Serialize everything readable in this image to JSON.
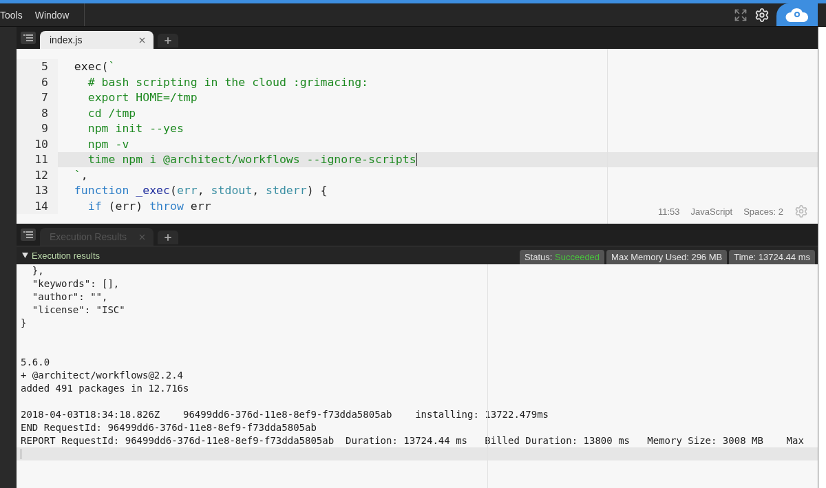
{
  "menu": [
    {
      "label": "Tools"
    },
    {
      "label": "Window"
    }
  ],
  "editor": {
    "tabs": [
      {
        "label": "index.js",
        "selected": true
      }
    ],
    "lines": [
      {
        "number": "5",
        "active": false,
        "tokens": [
          {
            "kind": "plain",
            "text": "  exec("
          },
          {
            "kind": "string",
            "text": "`"
          }
        ]
      },
      {
        "number": "6",
        "active": false,
        "tokens": [
          {
            "kind": "string",
            "text": "    # bash scripting in the cloud :grimacing:"
          }
        ]
      },
      {
        "number": "7",
        "active": false,
        "tokens": [
          {
            "kind": "string",
            "text": "    export HOME=/tmp"
          }
        ]
      },
      {
        "number": "8",
        "active": false,
        "tokens": [
          {
            "kind": "string",
            "text": "    cd /tmp"
          }
        ]
      },
      {
        "number": "9",
        "active": false,
        "tokens": [
          {
            "kind": "string",
            "text": "    npm init --yes"
          }
        ]
      },
      {
        "number": "10",
        "active": false,
        "tokens": [
          {
            "kind": "string",
            "text": "    npm -v"
          }
        ]
      },
      {
        "number": "11",
        "active": true,
        "tokens": [
          {
            "kind": "string",
            "text": "    time npm i @architect/workflows --ignore-scripts"
          }
        ]
      },
      {
        "number": "12",
        "active": false,
        "tokens": [
          {
            "kind": "string",
            "text": "  `"
          },
          {
            "kind": "plain",
            "text": ","
          }
        ]
      },
      {
        "number": "13",
        "active": false,
        "tokens": [
          {
            "kind": "keyword",
            "text": "  function"
          },
          {
            "kind": "name",
            "text": " _exec"
          },
          {
            "kind": "plain",
            "text": "("
          },
          {
            "kind": "param",
            "text": "err"
          },
          {
            "kind": "plain",
            "text": ", "
          },
          {
            "kind": "param",
            "text": "stdout"
          },
          {
            "kind": "plain",
            "text": ", "
          },
          {
            "kind": "param",
            "text": "stderr"
          },
          {
            "kind": "plain",
            "text": ") {"
          }
        ]
      },
      {
        "number": "14",
        "active": false,
        "tokens": [
          {
            "kind": "keyword",
            "text": "    if"
          },
          {
            "kind": "plain",
            "text": " (err) "
          },
          {
            "kind": "keyword",
            "text": "throw"
          },
          {
            "kind": "plain",
            "text": " err"
          }
        ]
      }
    ],
    "status": {
      "position": "11:53",
      "language": "JavaScript",
      "indent": "Spaces: 2"
    }
  },
  "results": {
    "tabs": [
      {
        "label": "Execution Results",
        "selected": false
      }
    ],
    "header": {
      "label": "Execution results",
      "expanded": true
    },
    "badges": [
      {
        "kind": "status",
        "label": "Status:",
        "value": "Succeeded"
      },
      {
        "kind": "plain",
        "label": "Max Memory Used: 296 MB"
      },
      {
        "kind": "plain",
        "label": "Time: 13724.44 ms"
      }
    ],
    "output": [
      {
        "wide_gap": false,
        "lines": [
          "  },",
          "  \"keywords\": [],",
          "  \"author\": \"\",",
          "  \"license\": \"ISC\"",
          "}"
        ]
      },
      {
        "wide_gap": true,
        "lines": [
          "5.6.0",
          "+ @architect/workflows@2.2.4",
          "added 491 packages in 12.716s"
        ]
      },
      {
        "wide_gap": false,
        "lines": [
          "2018-04-03T18:34:18.826Z    96499dd6-376d-11e8-8ef9-f73dda5805ab    installing: 13722.479ms",
          "END RequestId: 96499dd6-376d-11e8-8ef9-f73dda5805ab",
          "REPORT RequestId: 96499dd6-376d-11e8-8ef9-f73dda5805ab  Duration: 13724.44 ms   Billed Duration: 13800 ms   Memory Size: 3008 MB    Max"
        ]
      }
    ]
  }
}
